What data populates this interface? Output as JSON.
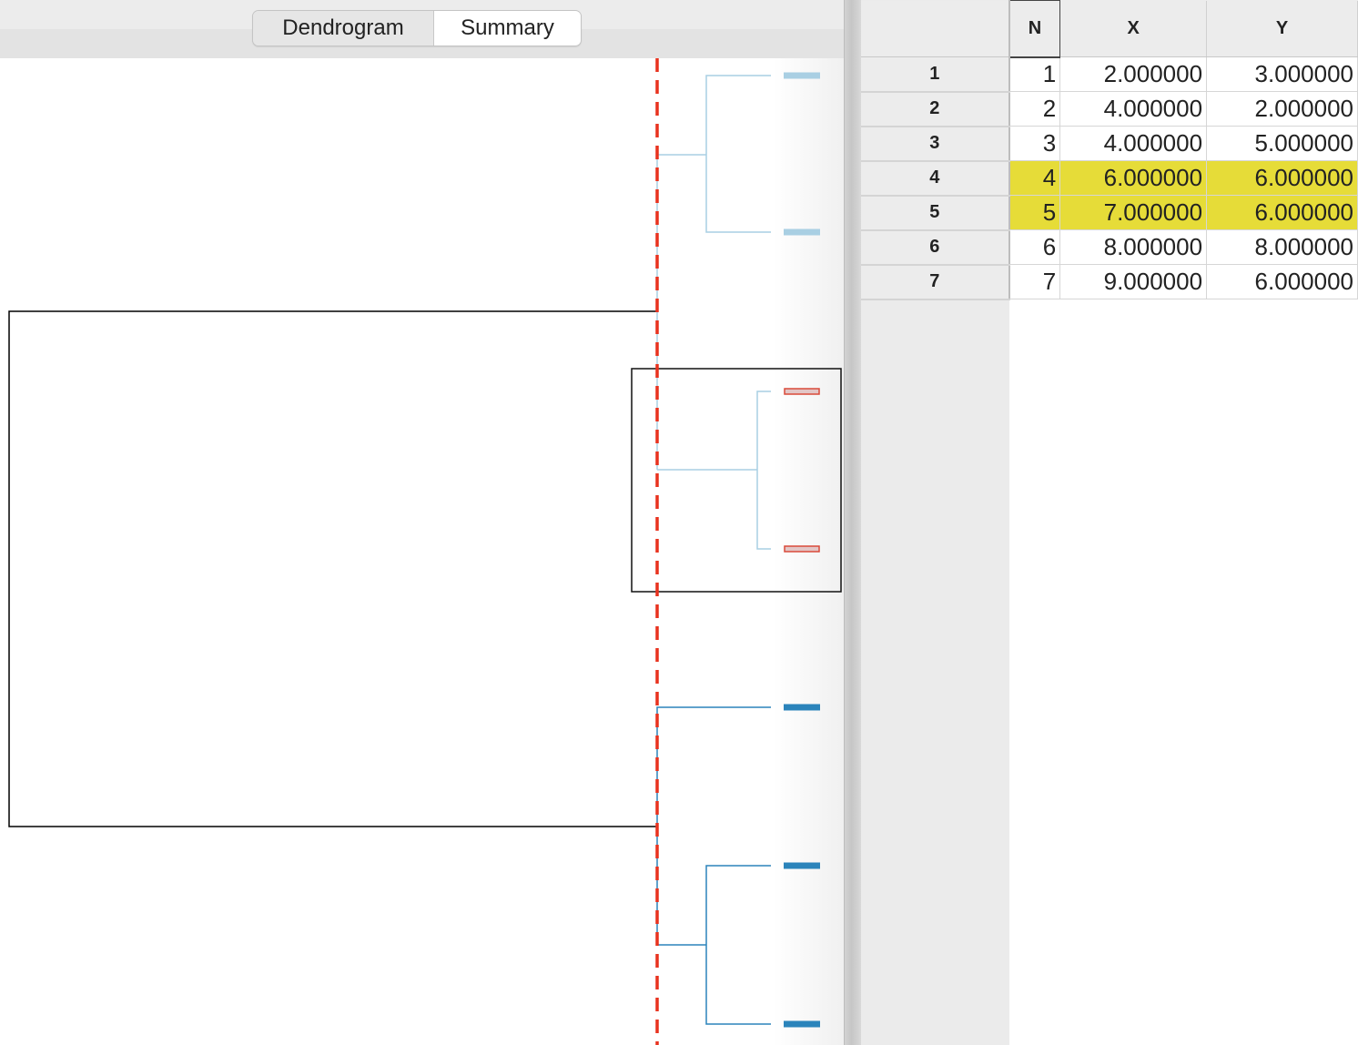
{
  "tabs": {
    "dendrogram_label": "Dendrogram",
    "summary_label": "Summary",
    "selected": "Summary"
  },
  "grid": {
    "columns": [
      "N",
      "X",
      "Y"
    ],
    "rows": [
      {
        "label": "1",
        "cells": [
          "1",
          "2.000000",
          "3.000000"
        ],
        "highlighted": false
      },
      {
        "label": "2",
        "cells": [
          "2",
          "4.000000",
          "2.000000"
        ],
        "highlighted": false
      },
      {
        "label": "3",
        "cells": [
          "3",
          "4.000000",
          "5.000000"
        ],
        "highlighted": false
      },
      {
        "label": "4",
        "cells": [
          "4",
          "6.000000",
          "6.000000"
        ],
        "highlighted": true
      },
      {
        "label": "5",
        "cells": [
          "5",
          "7.000000",
          "6.000000"
        ],
        "highlighted": true
      },
      {
        "label": "6",
        "cells": [
          "6",
          "8.000000",
          "8.000000"
        ],
        "highlighted": false
      },
      {
        "label": "7",
        "cells": [
          "7",
          "9.000000",
          "6.000000"
        ],
        "highlighted": false
      }
    ],
    "highlight_color": "#e6dc38"
  },
  "dendrogram": {
    "leaves": 6,
    "cut_line_color": "#e8321e",
    "cluster_colors": [
      "#a9cfe3",
      "#a9cfe3",
      "#2b84bb"
    ],
    "selected_cluster": 2,
    "selection_color": "#d94a3a"
  }
}
